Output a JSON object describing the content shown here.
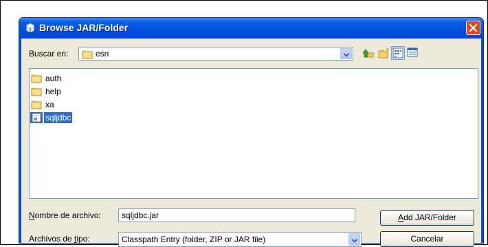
{
  "window": {
    "title": "Browse JAR/Folder"
  },
  "look_in": {
    "label": "Buscar en:",
    "value": "esn"
  },
  "toolbar": {
    "icons": [
      "up-folder-icon",
      "new-folder-icon",
      "list-view-icon",
      "details-view-icon"
    ],
    "active_view": "list"
  },
  "files": [
    {
      "name": "auth",
      "type": "folder",
      "selected": false
    },
    {
      "name": "help",
      "type": "folder",
      "selected": false
    },
    {
      "name": "xa",
      "type": "folder",
      "selected": false
    },
    {
      "name": "sqljdbc",
      "type": "jar",
      "selected": true
    }
  ],
  "file_name": {
    "label_first": "N",
    "label_rest": "ombre de archivo:",
    "value": "sqljdbc.jar"
  },
  "file_type": {
    "label_a": "Archivos de ",
    "label_u": "t",
    "label_b": "ipo:",
    "value": "Classpath Entry (folder, ZIP or JAR file)"
  },
  "buttons": {
    "add_u": "A",
    "add_rest": "dd JAR/Folder",
    "cancel": "Cancelar"
  },
  "colors": {
    "titlebar": "#0054e3",
    "selection": "#316ac5",
    "dialog_bg": "#ece9d8"
  }
}
